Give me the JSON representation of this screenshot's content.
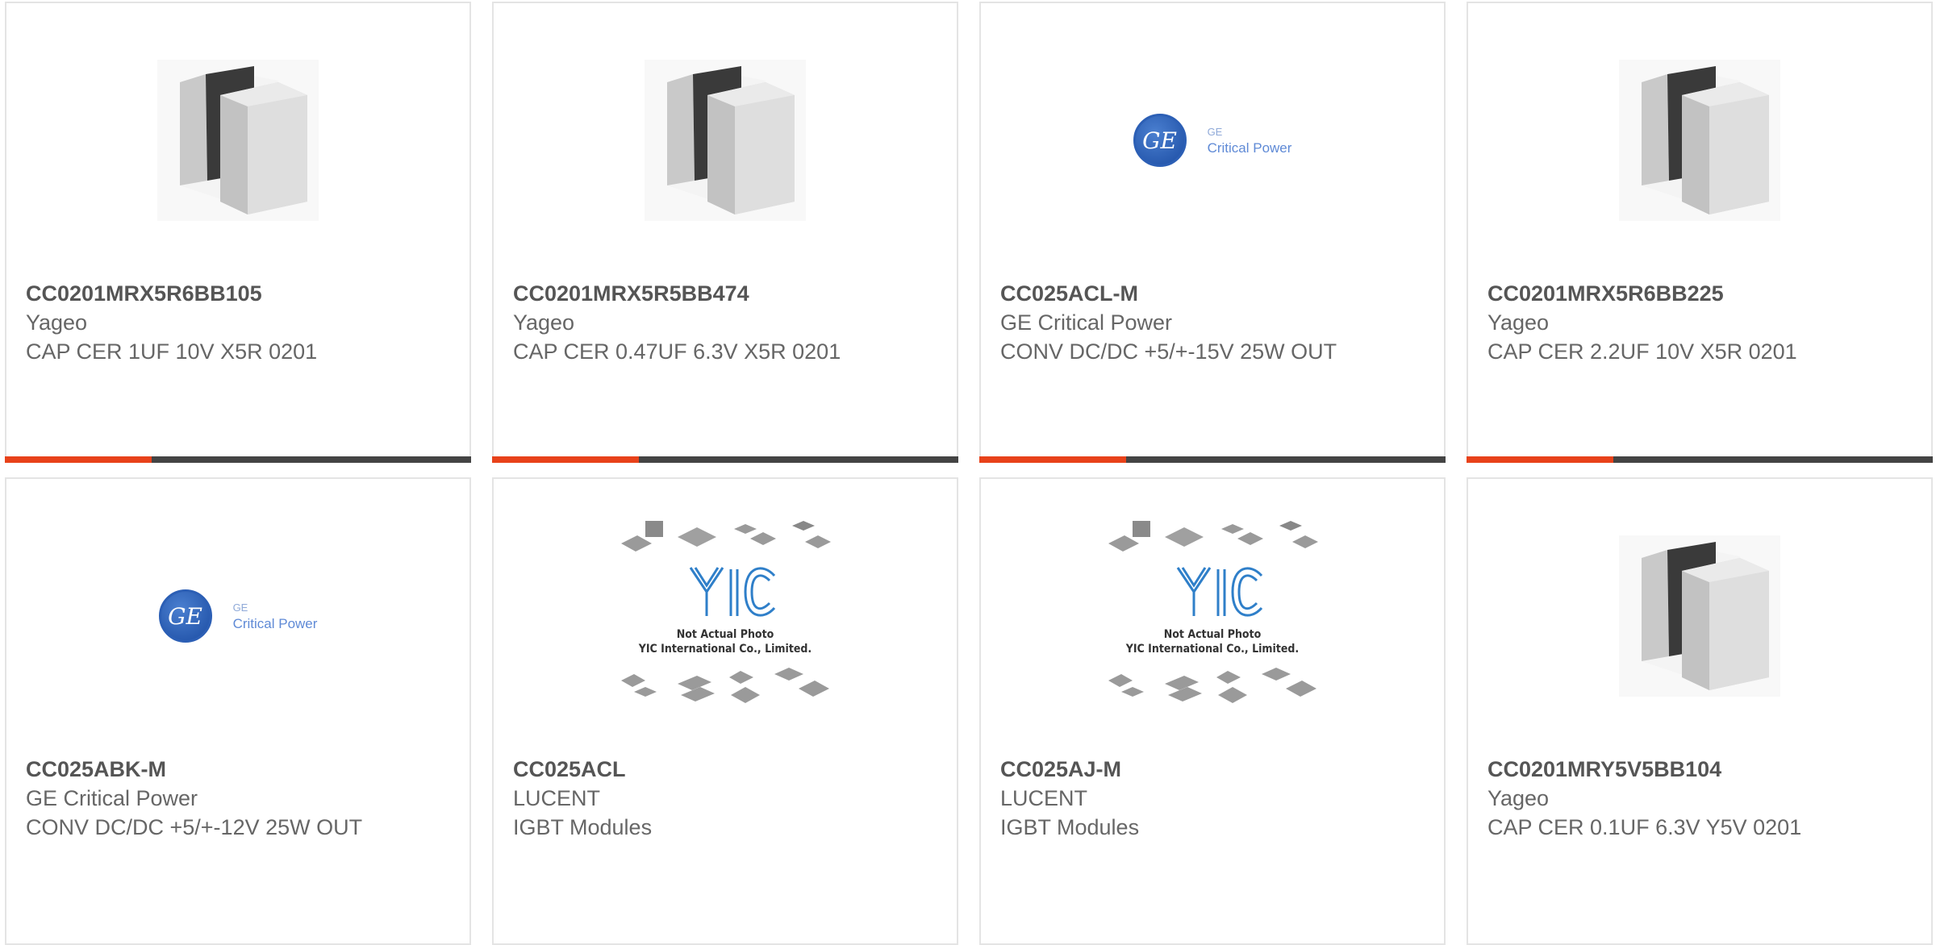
{
  "cards": [
    {
      "part": "CC0201MRX5R6BB105",
      "mfr": "Yageo",
      "desc": "CAP CER 1UF 10V X5R 0201",
      "image": "capacitor-chip"
    },
    {
      "part": "CC0201MRX5R5BB474",
      "mfr": "Yageo",
      "desc": "CAP CER 0.47UF 6.3V X5R 0201",
      "image": "capacitor-chip"
    },
    {
      "part": "CC025ACL-M",
      "mfr": "GE Critical Power",
      "desc": "CONV DC/DC +5/+-15V 25W OUT",
      "image": "ge-logo"
    },
    {
      "part": "CC0201MRX5R6BB225",
      "mfr": "Yageo",
      "desc": "CAP CER 2.2UF 10V X5R 0201",
      "image": "capacitor-chip"
    },
    {
      "part": "CC025ABK-M",
      "mfr": "GE Critical Power",
      "desc": "CONV DC/DC +5/+-12V 25W OUT",
      "image": "ge-logo"
    },
    {
      "part": "CC025ACL",
      "mfr": "LUCENT",
      "desc": "IGBT Modules",
      "image": "yic-placeholder"
    },
    {
      "part": "CC025AJ-M",
      "mfr": "LUCENT",
      "desc": "IGBT Modules",
      "image": "yic-placeholder"
    },
    {
      "part": "CC0201MRY5V5BB104",
      "mfr": "Yageo",
      "desc": "CAP CER 0.1UF 6.3V Y5V 0201",
      "image": "capacitor-chip"
    }
  ],
  "ge_logo": {
    "monogram": "GE",
    "line1": "GE",
    "line2": "Critical Power"
  },
  "yic": {
    "line1": "Not Actual Photo",
    "line2": "YIC International Co., Limited."
  },
  "colors": {
    "accent": "#e8421a",
    "bar": "#444444",
    "border": "#e4e4e4"
  }
}
